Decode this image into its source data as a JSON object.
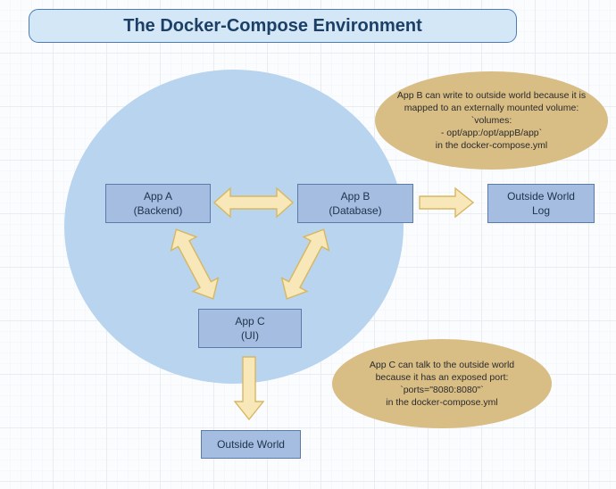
{
  "title": "The Docker-Compose Environment",
  "nodes": {
    "appA": {
      "line1": "App A",
      "line2": "(Backend)"
    },
    "appB": {
      "line1": "App B",
      "line2": "(Database)"
    },
    "appC": {
      "line1": "App C",
      "line2": "(UI)"
    },
    "outsideLog": {
      "line1": "Outside World",
      "line2": "Log"
    },
    "outsideWorld": {
      "line1": "Outside World"
    }
  },
  "callouts": {
    "top": {
      "l1": "App B can write to outside world because it is",
      "l2": "mapped to an externally mounted volume:",
      "l3": "`volumes:",
      "l4": "- opt/app:/opt/appB/app`",
      "l5": "in the docker-compose.yml"
    },
    "bottom": {
      "l1": "App C can talk to the outside world",
      "l2": "because it has an exposed port:",
      "l3": "`ports=\"8080:8080\"`",
      "l4": "in the docker-compose.yml"
    }
  },
  "colors": {
    "titleBg": "#d4e7f7",
    "titleBorder": "#4a7db5",
    "circle": "#b8d4ee",
    "nodeBg": "#a4bde0",
    "nodeBorder": "#5b7aa6",
    "calloutBg": "#d8bd85",
    "arrowFill": "#f8e7b8",
    "arrowStroke": "#d7b75f"
  }
}
